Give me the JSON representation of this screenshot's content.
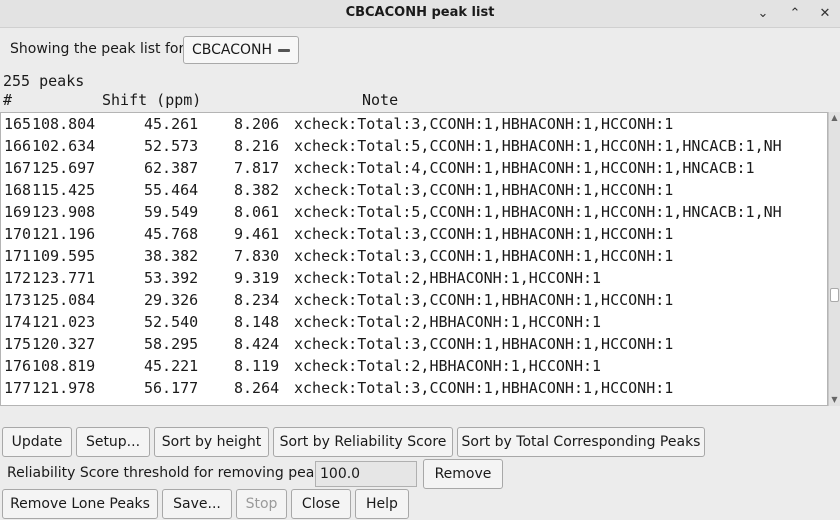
{
  "window": {
    "title": "CBCACONH peak list",
    "controls": [
      "chevron-down-icon",
      "chevron-up-icon",
      "close-icon"
    ]
  },
  "selector": {
    "label": "Showing the peak list for:",
    "selected": "CBCACONH"
  },
  "summary": {
    "count_text": "255 peaks"
  },
  "table": {
    "headers": {
      "num": "#",
      "shift": "Shift (ppm)",
      "note": "Note"
    },
    "rows": [
      {
        "num": "165",
        "s1": "108.804",
        "s2": "45.261",
        "s3": "8.206",
        "note": "xcheck:Total:3,CCONH:1,HBHACONH:1,HCCONH:1"
      },
      {
        "num": "166",
        "s1": "102.634",
        "s2": "52.573",
        "s3": "8.216",
        "note": "xcheck:Total:5,CCONH:1,HBHACONH:1,HCCONH:1,HNCACB:1,NH"
      },
      {
        "num": "167",
        "s1": "125.697",
        "s2": "62.387",
        "s3": "7.817",
        "note": "xcheck:Total:4,CCONH:1,HBHACONH:1,HCCONH:1,HNCACB:1"
      },
      {
        "num": "168",
        "s1": "115.425",
        "s2": "55.464",
        "s3": "8.382",
        "note": "xcheck:Total:3,CCONH:1,HBHACONH:1,HCCONH:1"
      },
      {
        "num": "169",
        "s1": "123.908",
        "s2": "59.549",
        "s3": "8.061",
        "note": "xcheck:Total:5,CCONH:1,HBHACONH:1,HCCONH:1,HNCACB:1,NH"
      },
      {
        "num": "170",
        "s1": "121.196",
        "s2": "45.768",
        "s3": "9.461",
        "note": "xcheck:Total:3,CCONH:1,HBHACONH:1,HCCONH:1"
      },
      {
        "num": "171",
        "s1": "109.595",
        "s2": "38.382",
        "s3": "7.830",
        "note": "xcheck:Total:3,CCONH:1,HBHACONH:1,HCCONH:1"
      },
      {
        "num": "172",
        "s1": "123.771",
        "s2": "53.392",
        "s3": "9.319",
        "note": "xcheck:Total:2,HBHACONH:1,HCCONH:1"
      },
      {
        "num": "173",
        "s1": "125.084",
        "s2": "29.326",
        "s3": "8.234",
        "note": "xcheck:Total:3,CCONH:1,HBHACONH:1,HCCONH:1"
      },
      {
        "num": "174",
        "s1": "121.023",
        "s2": "52.540",
        "s3": "8.148",
        "note": "xcheck:Total:2,HBHACONH:1,HCCONH:1"
      },
      {
        "num": "175",
        "s1": "120.327",
        "s2": "58.295",
        "s3": "8.424",
        "note": "xcheck:Total:3,CCONH:1,HBHACONH:1,HCCONH:1"
      },
      {
        "num": "176",
        "s1": "108.819",
        "s2": "45.221",
        "s3": "8.119",
        "note": "xcheck:Total:2,HBHACONH:1,HCCONH:1"
      },
      {
        "num": "177",
        "s1": "121.978",
        "s2": "56.177",
        "s3": "8.264",
        "note": "xcheck:Total:3,CCONH:1,HBHACONH:1,HCCONH:1"
      }
    ]
  },
  "scrollbar": {
    "position_fraction": 0.64,
    "visible_fraction": 0.05
  },
  "buttons": {
    "update": "Update",
    "setup": "Setup...",
    "sort_height": "Sort by height",
    "sort_reliability": "Sort by Reliability Score",
    "sort_total": "Sort by Total Corresponding Peaks",
    "remove": "Remove",
    "remove_lone": "Remove Lone Peaks",
    "save": "Save...",
    "stop": "Stop",
    "close": "Close",
    "help": "Help"
  },
  "threshold": {
    "label": "Reliability Score threshold for removing peaks:",
    "value": "100.0"
  }
}
